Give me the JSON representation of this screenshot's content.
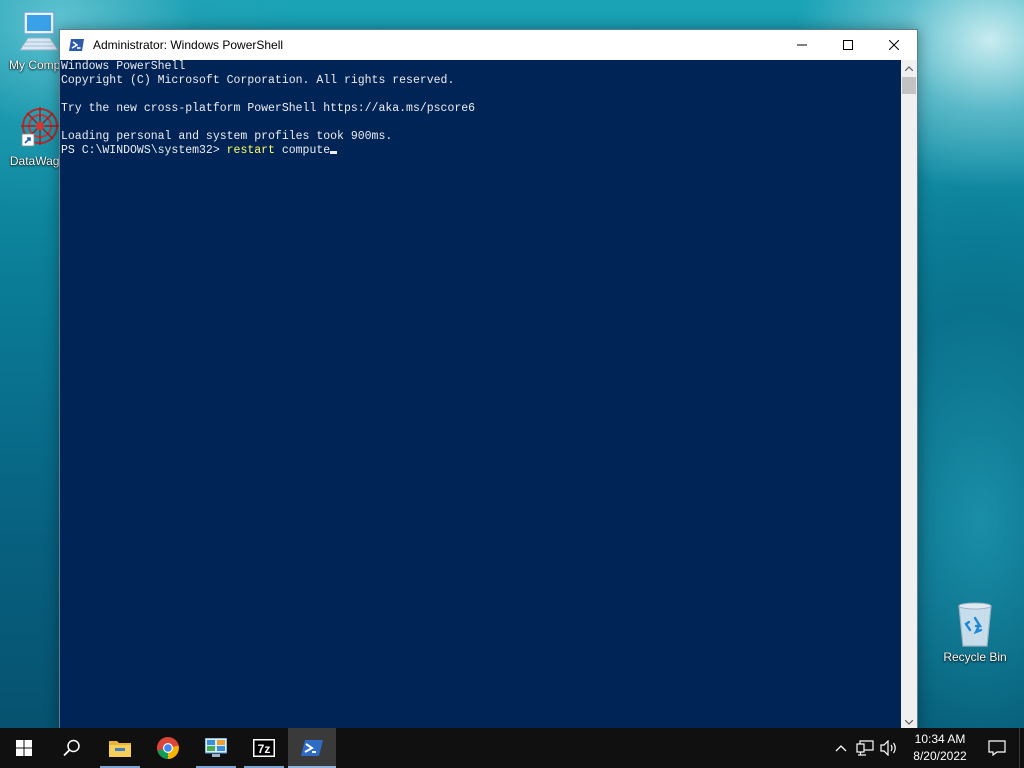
{
  "desktop": {
    "icons": [
      {
        "label": "My Compu",
        "icon": "computer-icon"
      },
      {
        "label": "DataWago",
        "icon": "datawagon-icon"
      },
      {
        "label": "Recycle Bin",
        "icon": "recycle-bin-icon"
      }
    ]
  },
  "window": {
    "title": "Administrator: Windows PowerShell",
    "icon": "powershell-icon",
    "controls": [
      "minimize-icon",
      "maximize-icon",
      "close-icon"
    ]
  },
  "console": {
    "lines": [
      "Windows PowerShell",
      "Copyright (C) Microsoft Corporation. All rights reserved.",
      "",
      "Try the new cross-platform PowerShell https://aka.ms/pscore6",
      "",
      "Loading personal and system profiles took 900ms."
    ],
    "prompt": "PS C:\\WINDOWS\\system32> ",
    "command": "restart",
    "argument": " compute",
    "colors": {
      "background": "#012456",
      "text": "#eeedf0",
      "command": "#ffff60"
    }
  },
  "taskbar": {
    "buttons": [
      {
        "name": "start",
        "icon": "windows-start-icon"
      },
      {
        "name": "search",
        "icon": "search-icon"
      },
      {
        "name": "file-explorer",
        "icon": "folder-icon"
      },
      {
        "name": "chrome",
        "icon": "chrome-icon"
      },
      {
        "name": "control-panel",
        "icon": "control-panel-icon"
      },
      {
        "name": "7zip",
        "icon": "7zip-icon",
        "text": "7z"
      },
      {
        "name": "powershell",
        "icon": "powershell-icon"
      }
    ],
    "tray": {
      "icons": [
        "chevron-up-icon",
        "network-icon",
        "volume-icon"
      ],
      "time": "10:34 AM",
      "date": "8/20/2022",
      "notification_icon": "notification-icon"
    }
  }
}
